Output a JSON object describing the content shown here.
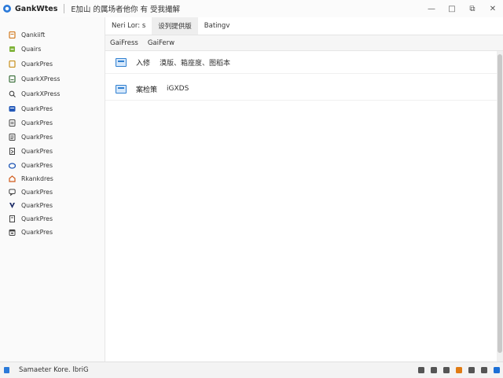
{
  "titlebar": {
    "app_name": "GankWtes",
    "window_title": "E加山 的属场者他你 有 受我撮解",
    "controls": {
      "minimize": "—",
      "maximize": "□",
      "restore": "⧉",
      "close": "✕"
    }
  },
  "sidebar": {
    "items": [
      {
        "label": "Qankiift",
        "icon": "document-icon",
        "color": "#d27a1f"
      },
      {
        "label": "Quairs",
        "icon": "leaf-icon",
        "color": "#5a8a25"
      },
      {
        "label": "QuarkPres",
        "icon": "page-icon",
        "color": "#c8901c"
      },
      {
        "label": "QuarkXPress",
        "icon": "page-icon",
        "color": "#3a6f3a"
      },
      {
        "label": "QuarkXPress",
        "icon": "search-icon",
        "color": "#444444"
      },
      {
        "label": "QuarkPres",
        "icon": "shield-icon",
        "color": "#2358b8"
      },
      {
        "label": "QuarkPres",
        "icon": "list-icon",
        "color": "#444444"
      },
      {
        "label": "QuarkPres",
        "icon": "page-icon",
        "color": "#444444"
      },
      {
        "label": "QuarkPres",
        "icon": "bookmark-icon",
        "color": "#444444"
      },
      {
        "label": "QuarkPres",
        "icon": "cloud-icon",
        "color": "#1f56b5"
      },
      {
        "label": "Rkankdres",
        "icon": "house-icon",
        "color": "#d05a1a"
      },
      {
        "label": "QuarkPres",
        "icon": "chat-icon",
        "color": "#444444"
      },
      {
        "label": "QuarkPres",
        "icon": "v-icon",
        "color": "#1c2a66"
      },
      {
        "label": "QuarkPres",
        "icon": "bookmark-icon",
        "color": "#444444"
      },
      {
        "label": "QuarkPres",
        "icon": "calendar-icon",
        "color": "#444444"
      }
    ]
  },
  "tabs": [
    {
      "label": "Neri Lor: s",
      "active": false
    },
    {
      "label": "设列提供版",
      "active": true
    },
    {
      "label": "Batingv",
      "active": false
    }
  ],
  "subtabs": [
    {
      "label": "GaiFress"
    },
    {
      "label": "GaiFerw"
    }
  ],
  "rows": [
    {
      "label": "入修",
      "detail": "漠版、箱座度、图稻本"
    },
    {
      "label": "案检策",
      "detail": "iGXDS"
    }
  ],
  "statusbar": {
    "text": "Samaeter Kore. lbriG",
    "tray_icons": [
      {
        "icon": "monitor-icon",
        "color": "#555555"
      },
      {
        "icon": "save-icon",
        "color": "#555555"
      },
      {
        "icon": "box-icon",
        "color": "#555555"
      },
      {
        "icon": "fire-icon",
        "color": "#e07b14"
      },
      {
        "icon": "network-icon",
        "color": "#555555"
      },
      {
        "icon": "bell-icon",
        "color": "#555555"
      },
      {
        "icon": "windows-icon",
        "color": "#1b6fd6"
      }
    ]
  }
}
